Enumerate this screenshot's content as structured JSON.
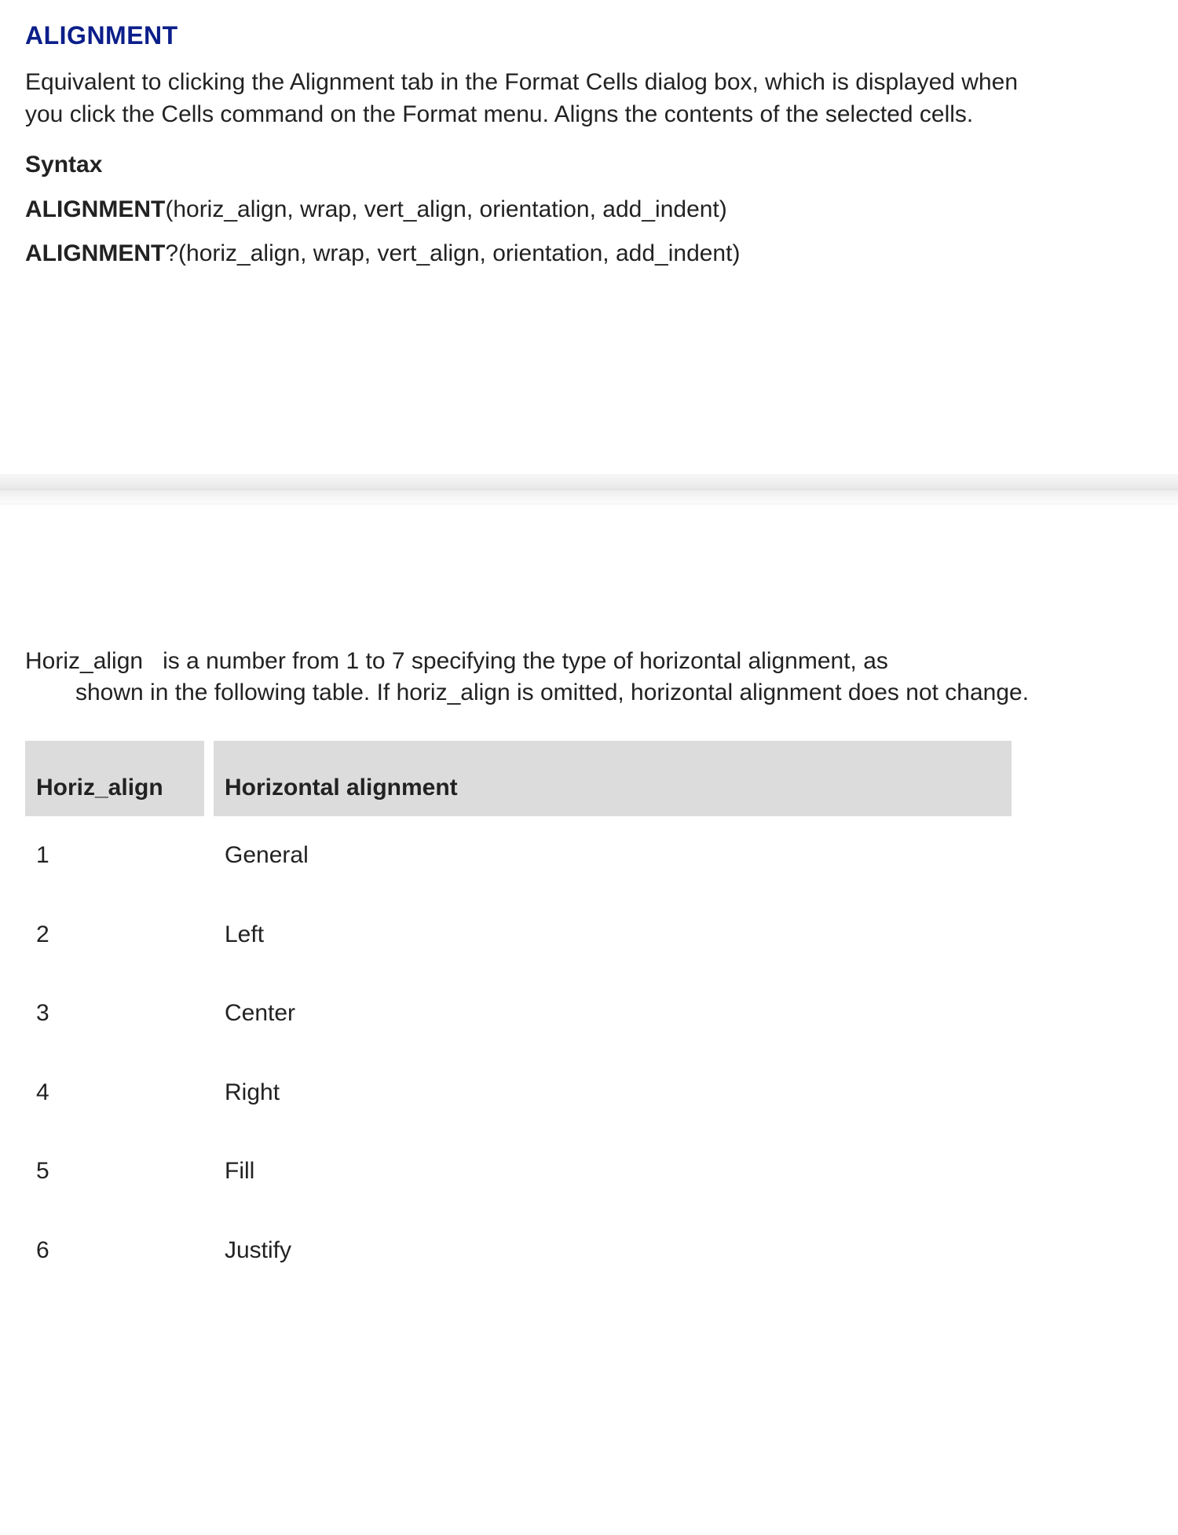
{
  "title": "ALIGNMENT",
  "description": "Equivalent to clicking the Alignment tab in the Format Cells dialog box, which is displayed when you click the Cells command on the Format menu. Aligns the contents of the selected cells.",
  "syntax_label": "Syntax",
  "syntax_lines": [
    {
      "fn": "ALIGNMENT",
      "args": "(horiz_align, wrap, vert_align, orientation, add_indent)"
    },
    {
      "fn": "ALIGNMENT",
      "q": "?",
      "args": "(horiz_align, wrap, vert_align, orientation, add_indent)"
    }
  ],
  "param": {
    "name": "Horiz_align",
    "gap": "   ",
    "text_first": "is a number from 1 to 7 specifying the type of horizontal alignment, as",
    "text_rest": "shown in the following table. If horiz_align is omitted, horizontal alignment does not change."
  },
  "table": {
    "headers": [
      "Horiz_align",
      "Horizontal alignment"
    ],
    "rows": [
      [
        "1",
        "General"
      ],
      [
        "2",
        "Left"
      ],
      [
        "3",
        "Center"
      ],
      [
        "4",
        "Right"
      ],
      [
        "5",
        "Fill"
      ],
      [
        "6",
        "Justify"
      ]
    ]
  }
}
